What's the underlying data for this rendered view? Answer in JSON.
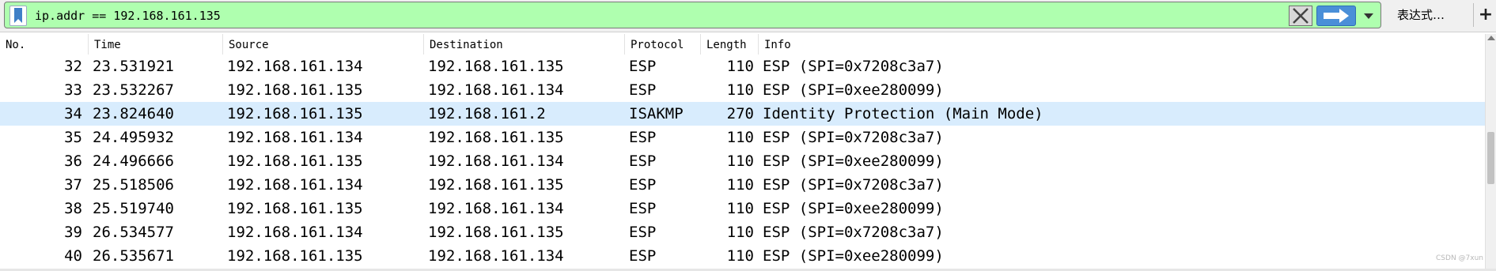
{
  "filter": {
    "value": "ip.addr == 192.168.161.135",
    "bg_color": "#afffaf",
    "bookmark_icon": "bookmark-icon",
    "clear_icon": "clear-x-icon",
    "apply_icon": "apply-arrow-icon",
    "dropdown_icon": "chevron-down-icon",
    "expression_label": "表达式…",
    "add_label": "+"
  },
  "packet_list": {
    "columns": [
      "No.",
      "Time",
      "Source",
      "Destination",
      "Protocol",
      "Length",
      "Info"
    ],
    "rows": [
      {
        "no": "32",
        "time": "23.531921",
        "source": "192.168.161.134",
        "destination": "192.168.161.135",
        "protocol": "ESP",
        "length": "110",
        "info": "ESP (SPI=0x7208c3a7)"
      },
      {
        "no": "33",
        "time": "23.532267",
        "source": "192.168.161.135",
        "destination": "192.168.161.134",
        "protocol": "ESP",
        "length": "110",
        "info": "ESP (SPI=0xee280099)"
      },
      {
        "no": "34",
        "time": "23.824640",
        "source": "192.168.161.135",
        "destination": "192.168.161.2",
        "protocol": "ISAKMP",
        "length": "270",
        "info": "Identity Protection (Main Mode)"
      },
      {
        "no": "35",
        "time": "24.495932",
        "source": "192.168.161.134",
        "destination": "192.168.161.135",
        "protocol": "ESP",
        "length": "110",
        "info": "ESP (SPI=0x7208c3a7)"
      },
      {
        "no": "36",
        "time": "24.496666",
        "source": "192.168.161.135",
        "destination": "192.168.161.134",
        "protocol": "ESP",
        "length": "110",
        "info": "ESP (SPI=0xee280099)"
      },
      {
        "no": "37",
        "time": "25.518506",
        "source": "192.168.161.134",
        "destination": "192.168.161.135",
        "protocol": "ESP",
        "length": "110",
        "info": "ESP (SPI=0x7208c3a7)"
      },
      {
        "no": "38",
        "time": "25.519740",
        "source": "192.168.161.135",
        "destination": "192.168.161.134",
        "protocol": "ESP",
        "length": "110",
        "info": "ESP (SPI=0xee280099)"
      },
      {
        "no": "39",
        "time": "26.534577",
        "source": "192.168.161.134",
        "destination": "192.168.161.135",
        "protocol": "ESP",
        "length": "110",
        "info": "ESP (SPI=0x7208c3a7)"
      },
      {
        "no": "40",
        "time": "26.535671",
        "source": "192.168.161.135",
        "destination": "192.168.161.134",
        "protocol": "ESP",
        "length": "110",
        "info": "ESP (SPI=0xee280099)"
      }
    ],
    "selected_no": "34",
    "selected_color": "#d8ecfd"
  },
  "watermark": "CSDN @7xun"
}
